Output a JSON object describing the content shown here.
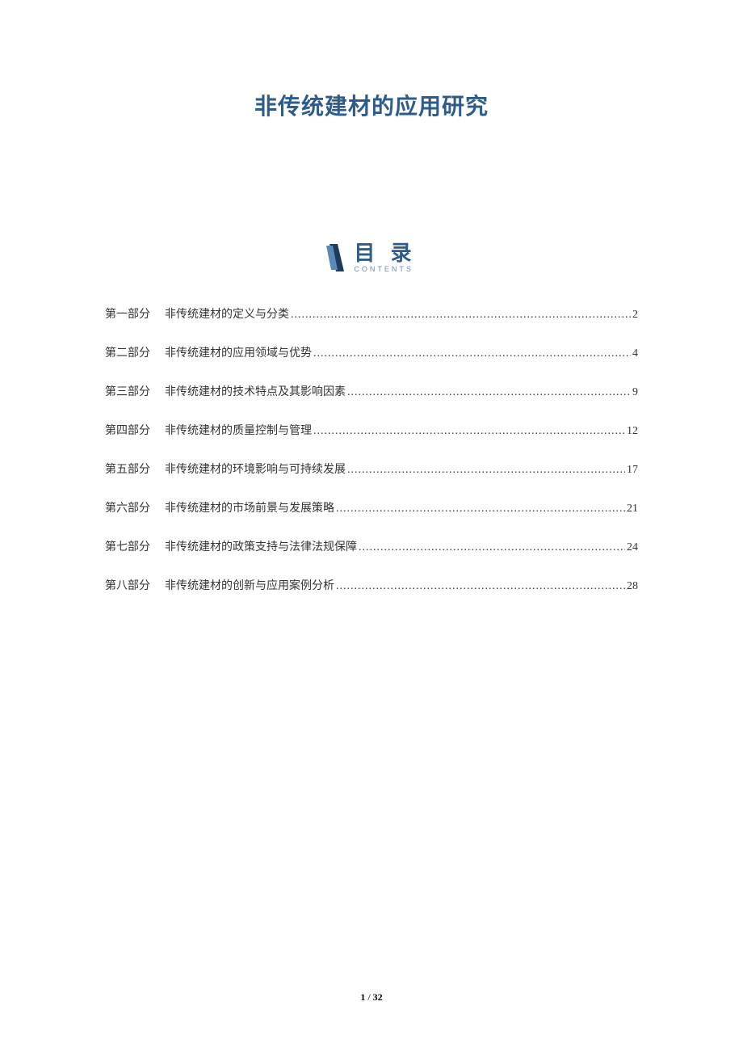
{
  "title": "非传统建材的应用研究",
  "tocHeader": {
    "title": "目 录",
    "subtitle": "CONTENTS"
  },
  "toc": [
    {
      "part": "第一部分",
      "chapter": "非传统建材的定义与分类",
      "page": "2"
    },
    {
      "part": "第二部分",
      "chapter": "非传统建材的应用领域与优势",
      "page": "4"
    },
    {
      "part": "第三部分",
      "chapter": "非传统建材的技术特点及其影响因素",
      "page": "9"
    },
    {
      "part": "第四部分",
      "chapter": "非传统建材的质量控制与管理",
      "page": "12"
    },
    {
      "part": "第五部分",
      "chapter": "非传统建材的环境影响与可持续发展",
      "page": "17"
    },
    {
      "part": "第六部分",
      "chapter": "非传统建材的市场前景与发展策略",
      "page": "21"
    },
    {
      "part": "第七部分",
      "chapter": "非传统建材的政策支持与法律法规保障",
      "page": "24"
    },
    {
      "part": "第八部分",
      "chapter": "非传统建材的创新与应用案例分析",
      "page": "28"
    }
  ],
  "footer": {
    "current": "1",
    "separator": " / ",
    "total": "32"
  }
}
